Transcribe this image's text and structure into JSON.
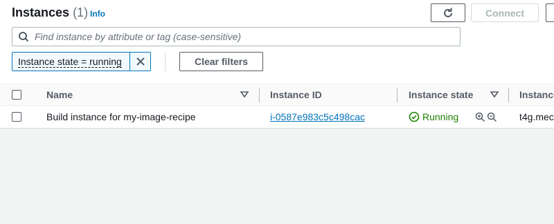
{
  "header": {
    "title": "Instances",
    "count": "(1)",
    "info": "Info",
    "connect_label": "Connect"
  },
  "search": {
    "placeholder": "Find instance by attribute or tag (case-sensitive)"
  },
  "filter": {
    "token": "Instance state = running",
    "clear_label": "Clear filters"
  },
  "table": {
    "columns": [
      "Name",
      "Instance ID",
      "Instance state",
      "Instance"
    ],
    "rows": [
      {
        "name": "Build instance for my-image-recipe",
        "instance_id": "i-0587e983c5c498cac",
        "state": "Running",
        "instance_type": "t4g.mec"
      }
    ]
  },
  "colors": {
    "link": "#0073bb",
    "running": "#1d8102",
    "border": "#545b64"
  },
  "icons": [
    "refresh-icon",
    "search-icon",
    "close-icon",
    "sort-caret-icon",
    "success-icon",
    "zoom-in-icon",
    "zoom-out-icon"
  ]
}
